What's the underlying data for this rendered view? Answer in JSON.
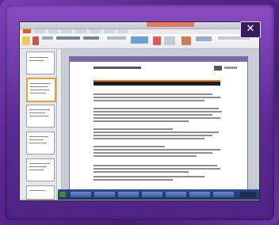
{
  "window": {
    "close_glyph": "✕"
  },
  "colors": {
    "frame": "#5e2a8e",
    "accent_orange": "#f07828",
    "title_red": "#e87a64"
  },
  "icons": [
    "close-icon"
  ]
}
